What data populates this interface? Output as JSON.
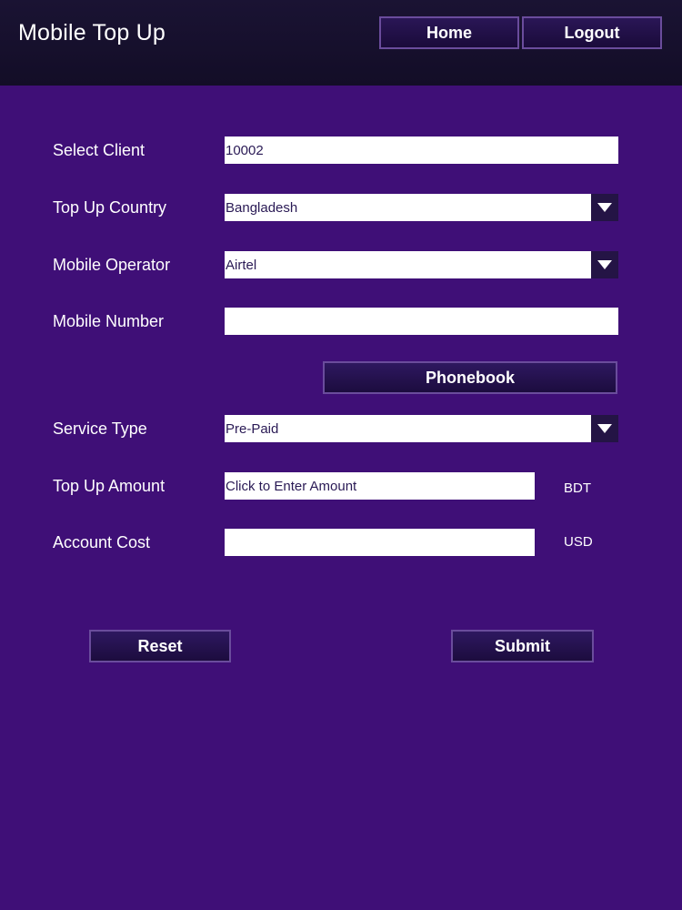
{
  "header": {
    "title": "Mobile Top Up",
    "home_label": "Home",
    "logout_label": "Logout"
  },
  "form": {
    "client": {
      "label": "Select Client",
      "value": "10002"
    },
    "country": {
      "label": "Top Up Country",
      "value": "Bangladesh"
    },
    "operator": {
      "label": "Mobile Operator",
      "value": "Airtel"
    },
    "mobile_number": {
      "label": "Mobile Number",
      "value": ""
    },
    "phonebook_label": "Phonebook",
    "service_type": {
      "label": "Service Type",
      "value": "Pre-Paid"
    },
    "amount": {
      "label": "Top Up Amount",
      "placeholder": "Click to Enter Amount",
      "unit": "BDT"
    },
    "cost": {
      "label": "Account Cost",
      "value": "",
      "unit": "USD"
    }
  },
  "actions": {
    "reset_label": "Reset",
    "submit_label": "Submit"
  },
  "colors": {
    "background": "#3f0f77",
    "header": "#150e2b",
    "button_border": "#6a4c9c",
    "dropdown_arrow_bg": "#241445"
  },
  "icons": {
    "dropdown": "chevron-down-icon"
  }
}
